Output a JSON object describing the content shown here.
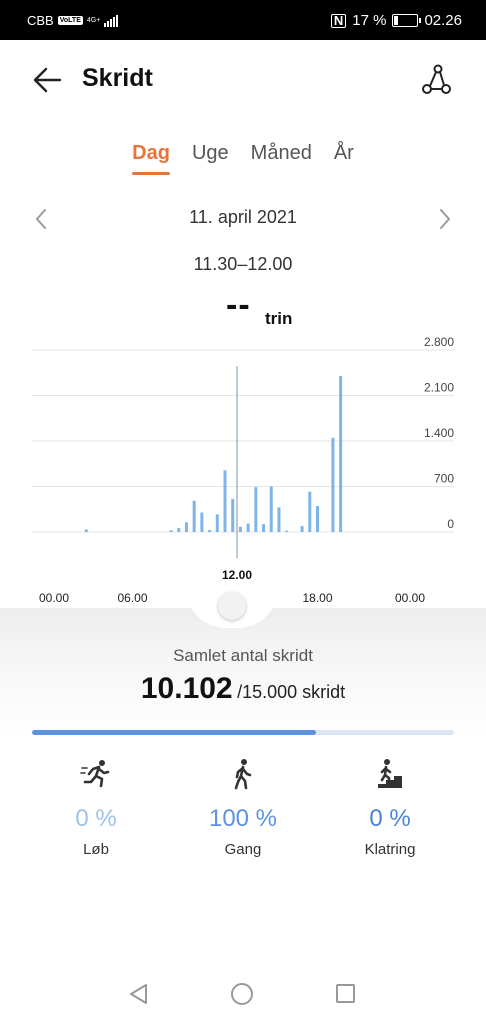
{
  "status_bar": {
    "carrier": "CBB",
    "volte": "VoLTE",
    "network": "4G+",
    "nfc": "N",
    "battery_text": "17 %",
    "battery_level": 0.17,
    "time": "02.26"
  },
  "header": {
    "title": "Skridt"
  },
  "tabs": [
    {
      "label": "Dag",
      "active": true
    },
    {
      "label": "Uge",
      "active": false
    },
    {
      "label": "Måned",
      "active": false
    },
    {
      "label": "År",
      "active": false
    }
  ],
  "date_nav": {
    "date": "11. april 2021",
    "time_range": "11.30–12.00"
  },
  "selected": {
    "value": "--",
    "unit": "trin"
  },
  "chart_data": {
    "type": "bar",
    "y_ticks": [
      "2.800",
      "2.100",
      "1.400",
      "700",
      "0"
    ],
    "ylim": [
      0,
      2800
    ],
    "x_ticks": [
      "00.00",
      "06.00",
      "12.00",
      "18.00",
      "00.00"
    ],
    "selected_tick": "12.00",
    "x_range_hours": [
      0,
      24
    ],
    "bar_color": "#7fb5e6",
    "bars": [
      {
        "hour": 3.0,
        "value": 40
      },
      {
        "hour": 8.5,
        "value": 25
      },
      {
        "hour": 9.0,
        "value": 60
      },
      {
        "hour": 9.5,
        "value": 150
      },
      {
        "hour": 10.0,
        "value": 480
      },
      {
        "hour": 10.5,
        "value": 300
      },
      {
        "hour": 11.0,
        "value": 30
      },
      {
        "hour": 11.5,
        "value": 270
      },
      {
        "hour": 12.0,
        "value": 950
      },
      {
        "hour": 12.5,
        "value": 510
      },
      {
        "hour": 13.0,
        "value": 80
      },
      {
        "hour": 13.5,
        "value": 130
      },
      {
        "hour": 14.0,
        "value": 690
      },
      {
        "hour": 14.5,
        "value": 120
      },
      {
        "hour": 15.0,
        "value": 700
      },
      {
        "hour": 15.5,
        "value": 380
      },
      {
        "hour": 16.0,
        "value": 20
      },
      {
        "hour": 17.0,
        "value": 90
      },
      {
        "hour": 17.5,
        "value": 620
      },
      {
        "hour": 18.0,
        "value": 400
      },
      {
        "hour": 19.0,
        "value": 1450
      },
      {
        "hour": 19.5,
        "value": 2400
      }
    ],
    "selection_hour": 13.3
  },
  "summary": {
    "label": "Samlet antal skridt",
    "total": "10.102",
    "goal": "/15.000 skridt",
    "progress": 0.673
  },
  "activities": [
    {
      "icon": "running-icon",
      "percent": "0 %",
      "label": "Løb",
      "color": "#9ec2ec"
    },
    {
      "icon": "walking-icon",
      "percent": "100 %",
      "label": "Gang",
      "color": "#5b93e0"
    },
    {
      "icon": "climbing-icon",
      "percent": "0 %",
      "label": "Klatring",
      "color": "#4a84d6"
    }
  ],
  "colors": {
    "accent": "#e8743b",
    "chart_bar": "#7fb5e6",
    "progress": "#5b93e0"
  }
}
